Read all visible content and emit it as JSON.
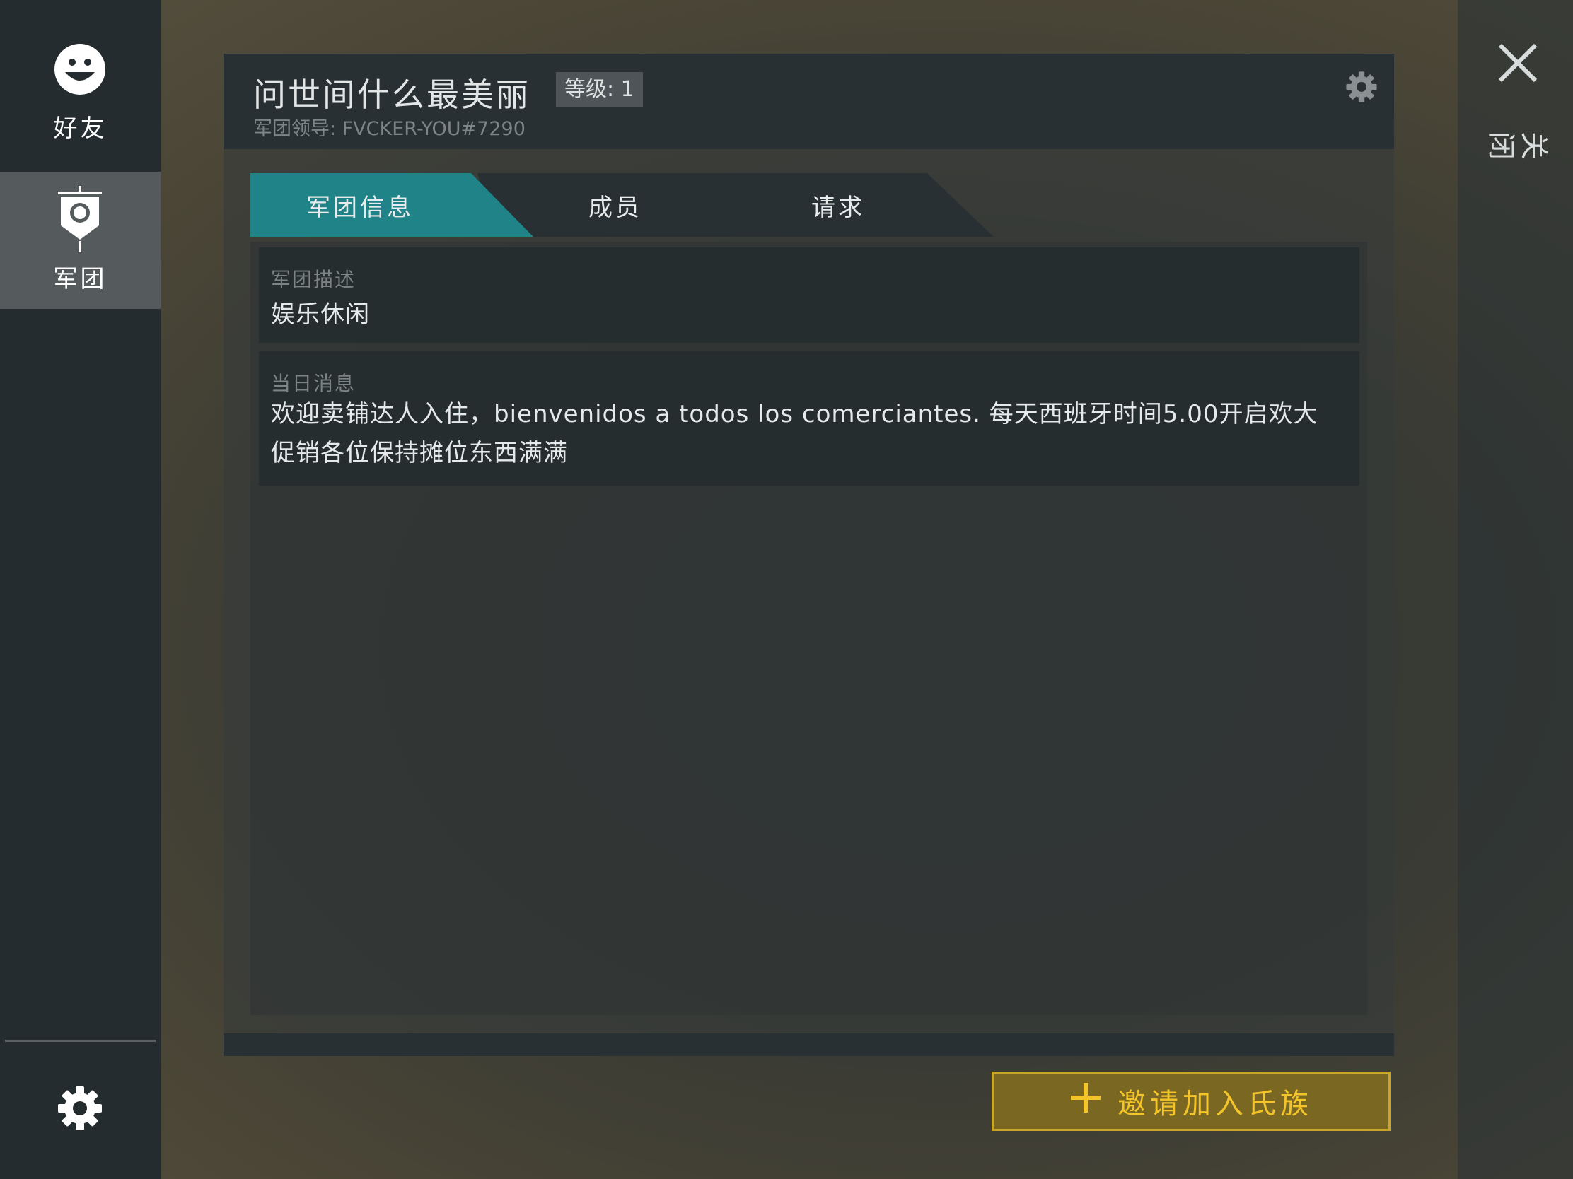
{
  "sidebar": {
    "items": [
      {
        "label": "好友",
        "icon": "smiley-face-icon"
      },
      {
        "label": "军团",
        "icon": "legion-banner-icon"
      }
    ],
    "settings_icon": "gear-icon"
  },
  "close": {
    "label": "关闭",
    "icon": "close-icon"
  },
  "header": {
    "legion_name": "问世间什么最美丽",
    "level": "等级: 1",
    "leader": "军团领导: FVCKER-YOU#7290",
    "settings_icon": "gear-icon"
  },
  "tabs": [
    {
      "label": "军团信息",
      "active": true
    },
    {
      "label": "成员",
      "active": false
    },
    {
      "label": "请求",
      "active": false
    }
  ],
  "description": {
    "label": "军团描述",
    "text": "娱乐休闲"
  },
  "motd": {
    "label": "当日消息",
    "text": "欢迎卖铺达人入住，bienvenidos a todos los comerciantes. 每天西班牙时间5.00开启欢大促销各位保持摊位东西满满"
  },
  "invite_button": {
    "label": "邀请加入氏族",
    "icon": "plus-icon"
  },
  "colors": {
    "accent_tab": "#1f8388",
    "invite_bg": "#7a6722",
    "invite_text": "#f3c52a",
    "panel_dark": "#283033"
  }
}
